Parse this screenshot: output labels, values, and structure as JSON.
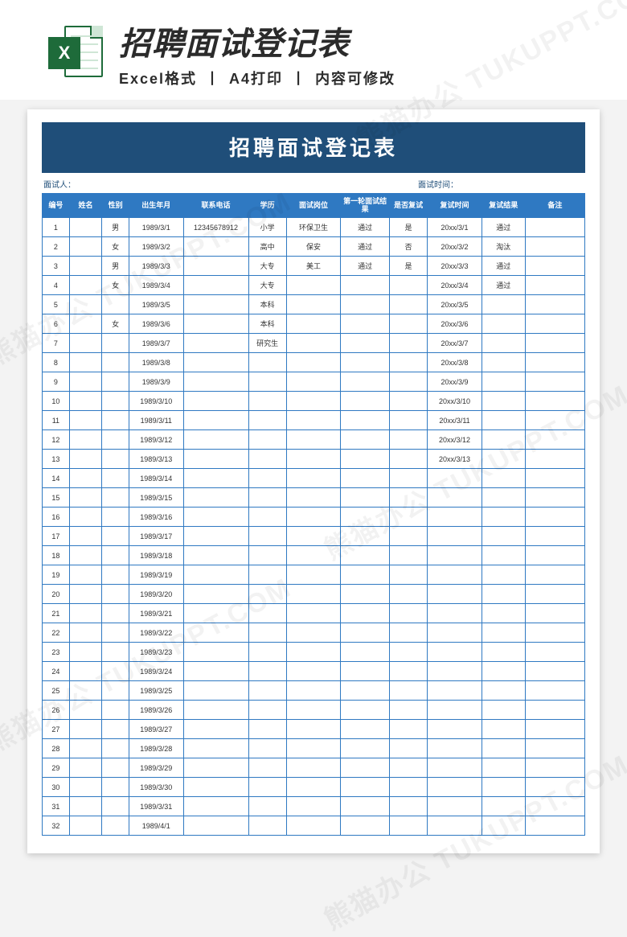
{
  "hero": {
    "excel_letter": "X",
    "title": "招聘面试登记表",
    "sub1": "Excel格式",
    "sub2": "A4打印",
    "sub3": "内容可修改"
  },
  "watermark": "熊猫办公 TUKUPPT.COM",
  "sheet": {
    "title": "招聘面试登记表",
    "meta_left": "面试人：",
    "meta_right": "面试时间：",
    "headers": [
      "编号",
      "姓名",
      "性别",
      "出生年月",
      "联系电话",
      "学历",
      "面试岗位",
      "第一轮面试结果",
      "是否复试",
      "复试时间",
      "复试结果",
      "备注"
    ],
    "rows": [
      {
        "idx": "1",
        "name": "",
        "sex": "男",
        "dob": "1989/3/1",
        "tel": "12345678912",
        "edu": "小学",
        "pos": "环保卫生",
        "r1": "通过",
        "re": "是",
        "rt": "20xx/3/1",
        "rr": "通过",
        "note": ""
      },
      {
        "idx": "2",
        "name": "",
        "sex": "女",
        "dob": "1989/3/2",
        "tel": "",
        "edu": "高中",
        "pos": "保安",
        "r1": "通过",
        "re": "否",
        "rt": "20xx/3/2",
        "rr": "淘汰",
        "note": ""
      },
      {
        "idx": "3",
        "name": "",
        "sex": "男",
        "dob": "1989/3/3",
        "tel": "",
        "edu": "大专",
        "pos": "美工",
        "r1": "通过",
        "re": "是",
        "rt": "20xx/3/3",
        "rr": "通过",
        "note": ""
      },
      {
        "idx": "4",
        "name": "",
        "sex": "女",
        "dob": "1989/3/4",
        "tel": "",
        "edu": "大专",
        "pos": "",
        "r1": "",
        "re": "",
        "rt": "20xx/3/4",
        "rr": "通过",
        "note": ""
      },
      {
        "idx": "5",
        "name": "",
        "sex": "",
        "dob": "1989/3/5",
        "tel": "",
        "edu": "本科",
        "pos": "",
        "r1": "",
        "re": "",
        "rt": "20xx/3/5",
        "rr": "",
        "note": ""
      },
      {
        "idx": "6",
        "name": "",
        "sex": "女",
        "dob": "1989/3/6",
        "tel": "",
        "edu": "本科",
        "pos": "",
        "r1": "",
        "re": "",
        "rt": "20xx/3/6",
        "rr": "",
        "note": ""
      },
      {
        "idx": "7",
        "name": "",
        "sex": "",
        "dob": "1989/3/7",
        "tel": "",
        "edu": "研究生",
        "pos": "",
        "r1": "",
        "re": "",
        "rt": "20xx/3/7",
        "rr": "",
        "note": ""
      },
      {
        "idx": "8",
        "name": "",
        "sex": "",
        "dob": "1989/3/8",
        "tel": "",
        "edu": "",
        "pos": "",
        "r1": "",
        "re": "",
        "rt": "20xx/3/8",
        "rr": "",
        "note": ""
      },
      {
        "idx": "9",
        "name": "",
        "sex": "",
        "dob": "1989/3/9",
        "tel": "",
        "edu": "",
        "pos": "",
        "r1": "",
        "re": "",
        "rt": "20xx/3/9",
        "rr": "",
        "note": ""
      },
      {
        "idx": "10",
        "name": "",
        "sex": "",
        "dob": "1989/3/10",
        "tel": "",
        "edu": "",
        "pos": "",
        "r1": "",
        "re": "",
        "rt": "20xx/3/10",
        "rr": "",
        "note": ""
      },
      {
        "idx": "11",
        "name": "",
        "sex": "",
        "dob": "1989/3/11",
        "tel": "",
        "edu": "",
        "pos": "",
        "r1": "",
        "re": "",
        "rt": "20xx/3/11",
        "rr": "",
        "note": ""
      },
      {
        "idx": "12",
        "name": "",
        "sex": "",
        "dob": "1989/3/12",
        "tel": "",
        "edu": "",
        "pos": "",
        "r1": "",
        "re": "",
        "rt": "20xx/3/12",
        "rr": "",
        "note": ""
      },
      {
        "idx": "13",
        "name": "",
        "sex": "",
        "dob": "1989/3/13",
        "tel": "",
        "edu": "",
        "pos": "",
        "r1": "",
        "re": "",
        "rt": "20xx/3/13",
        "rr": "",
        "note": ""
      },
      {
        "idx": "14",
        "name": "",
        "sex": "",
        "dob": "1989/3/14",
        "tel": "",
        "edu": "",
        "pos": "",
        "r1": "",
        "re": "",
        "rt": "",
        "rr": "",
        "note": ""
      },
      {
        "idx": "15",
        "name": "",
        "sex": "",
        "dob": "1989/3/15",
        "tel": "",
        "edu": "",
        "pos": "",
        "r1": "",
        "re": "",
        "rt": "",
        "rr": "",
        "note": ""
      },
      {
        "idx": "16",
        "name": "",
        "sex": "",
        "dob": "1989/3/16",
        "tel": "",
        "edu": "",
        "pos": "",
        "r1": "",
        "re": "",
        "rt": "",
        "rr": "",
        "note": ""
      },
      {
        "idx": "17",
        "name": "",
        "sex": "",
        "dob": "1989/3/17",
        "tel": "",
        "edu": "",
        "pos": "",
        "r1": "",
        "re": "",
        "rt": "",
        "rr": "",
        "note": ""
      },
      {
        "idx": "18",
        "name": "",
        "sex": "",
        "dob": "1989/3/18",
        "tel": "",
        "edu": "",
        "pos": "",
        "r1": "",
        "re": "",
        "rt": "",
        "rr": "",
        "note": ""
      },
      {
        "idx": "19",
        "name": "",
        "sex": "",
        "dob": "1989/3/19",
        "tel": "",
        "edu": "",
        "pos": "",
        "r1": "",
        "re": "",
        "rt": "",
        "rr": "",
        "note": ""
      },
      {
        "idx": "20",
        "name": "",
        "sex": "",
        "dob": "1989/3/20",
        "tel": "",
        "edu": "",
        "pos": "",
        "r1": "",
        "re": "",
        "rt": "",
        "rr": "",
        "note": ""
      },
      {
        "idx": "21",
        "name": "",
        "sex": "",
        "dob": "1989/3/21",
        "tel": "",
        "edu": "",
        "pos": "",
        "r1": "",
        "re": "",
        "rt": "",
        "rr": "",
        "note": ""
      },
      {
        "idx": "22",
        "name": "",
        "sex": "",
        "dob": "1989/3/22",
        "tel": "",
        "edu": "",
        "pos": "",
        "r1": "",
        "re": "",
        "rt": "",
        "rr": "",
        "note": ""
      },
      {
        "idx": "23",
        "name": "",
        "sex": "",
        "dob": "1989/3/23",
        "tel": "",
        "edu": "",
        "pos": "",
        "r1": "",
        "re": "",
        "rt": "",
        "rr": "",
        "note": ""
      },
      {
        "idx": "24",
        "name": "",
        "sex": "",
        "dob": "1989/3/24",
        "tel": "",
        "edu": "",
        "pos": "",
        "r1": "",
        "re": "",
        "rt": "",
        "rr": "",
        "note": ""
      },
      {
        "idx": "25",
        "name": "",
        "sex": "",
        "dob": "1989/3/25",
        "tel": "",
        "edu": "",
        "pos": "",
        "r1": "",
        "re": "",
        "rt": "",
        "rr": "",
        "note": ""
      },
      {
        "idx": "26",
        "name": "",
        "sex": "",
        "dob": "1989/3/26",
        "tel": "",
        "edu": "",
        "pos": "",
        "r1": "",
        "re": "",
        "rt": "",
        "rr": "",
        "note": ""
      },
      {
        "idx": "27",
        "name": "",
        "sex": "",
        "dob": "1989/3/27",
        "tel": "",
        "edu": "",
        "pos": "",
        "r1": "",
        "re": "",
        "rt": "",
        "rr": "",
        "note": ""
      },
      {
        "idx": "28",
        "name": "",
        "sex": "",
        "dob": "1989/3/28",
        "tel": "",
        "edu": "",
        "pos": "",
        "r1": "",
        "re": "",
        "rt": "",
        "rr": "",
        "note": ""
      },
      {
        "idx": "29",
        "name": "",
        "sex": "",
        "dob": "1989/3/29",
        "tel": "",
        "edu": "",
        "pos": "",
        "r1": "",
        "re": "",
        "rt": "",
        "rr": "",
        "note": ""
      },
      {
        "idx": "30",
        "name": "",
        "sex": "",
        "dob": "1989/3/30",
        "tel": "",
        "edu": "",
        "pos": "",
        "r1": "",
        "re": "",
        "rt": "",
        "rr": "",
        "note": ""
      },
      {
        "idx": "31",
        "name": "",
        "sex": "",
        "dob": "1989/3/31",
        "tel": "",
        "edu": "",
        "pos": "",
        "r1": "",
        "re": "",
        "rt": "",
        "rr": "",
        "note": ""
      },
      {
        "idx": "32",
        "name": "",
        "sex": "",
        "dob": "1989/4/1",
        "tel": "",
        "edu": "",
        "pos": "",
        "r1": "",
        "re": "",
        "rt": "",
        "rr": "",
        "note": ""
      }
    ]
  }
}
